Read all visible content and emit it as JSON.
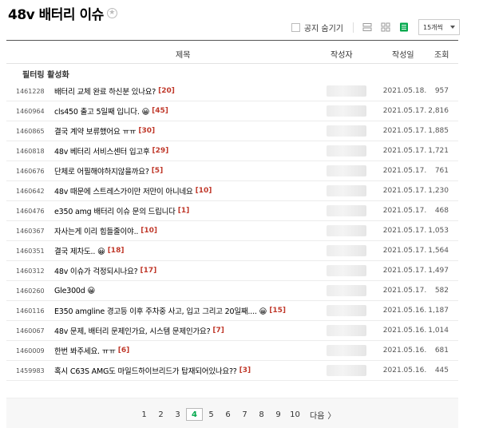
{
  "header": {
    "title": "48v 배터리 이슈"
  },
  "controls": {
    "notice_hide_label": "공지 숨기기",
    "page_size_selected": "15개씩",
    "accent_color": "#03a94d"
  },
  "table": {
    "columns": {
      "subject": "제목",
      "author": "작성자",
      "date": "작성일",
      "views": "조회"
    },
    "filter_label": "필터링 활성화",
    "rows": [
      {
        "no": "1461228",
        "subject": "배터리 교체 완료 하신분 있나요?",
        "comments": "[20]",
        "date": "2021.05.18.",
        "views": "957"
      },
      {
        "no": "1460964",
        "subject": "cls450 출고 5일째 입니다. 😀",
        "comments": "[45]",
        "date": "2021.05.17.",
        "views": "2,816"
      },
      {
        "no": "1460865",
        "subject": "결국 계약 보류했어요 ㅠㅠ",
        "comments": "[30]",
        "date": "2021.05.17.",
        "views": "1,885"
      },
      {
        "no": "1460818",
        "subject": "48v 베터리 서비스센터 입고후",
        "comments": "[29]",
        "date": "2021.05.17.",
        "views": "1,721"
      },
      {
        "no": "1460676",
        "subject": "단체로 어필해야하지않을까요?",
        "comments": "[5]",
        "date": "2021.05.17.",
        "views": "761"
      },
      {
        "no": "1460642",
        "subject": "48v 때문에 스트레스가이만 저만이 아니네요",
        "comments": "[10]",
        "date": "2021.05.17.",
        "views": "1,230"
      },
      {
        "no": "1460476",
        "subject": "e350 amg 배터리 이슈 문의 드립니다",
        "comments": "[1]",
        "date": "2021.05.17.",
        "views": "468"
      },
      {
        "no": "1460367",
        "subject": "자사는게 이리 힘들줄이야..",
        "comments": "[10]",
        "date": "2021.05.17.",
        "views": "1,053"
      },
      {
        "no": "1460351",
        "subject": "결국 제차도.. 😀",
        "comments": "[18]",
        "date": "2021.05.17.",
        "views": "1,564"
      },
      {
        "no": "1460312",
        "subject": "48v 이슈가 걱정되시나요?",
        "comments": "[17]",
        "date": "2021.05.17.",
        "views": "1,497"
      },
      {
        "no": "1460260",
        "subject": "Gle300d 😀",
        "comments": "",
        "date": "2021.05.17.",
        "views": "582"
      },
      {
        "no": "1460116",
        "subject": "E350 amgline 경고등 이후 주차중 사고, 입고 그리고 20일째.... 😀",
        "comments": "[15]",
        "date": "2021.05.16.",
        "views": "1,187"
      },
      {
        "no": "1460067",
        "subject": "48v 문제, 배터리 문제인가요, 시스템 문제인가요?",
        "comments": "[7]",
        "date": "2021.05.16.",
        "views": "1,014"
      },
      {
        "no": "1460009",
        "subject": "한번 봐주세요. ㅠㅠ",
        "comments": "[6]",
        "date": "2021.05.16.",
        "views": "681"
      },
      {
        "no": "1459983",
        "subject": "혹시 C63S AMG도 마일드하이브리드가 탑재되어있나요??",
        "comments": "[3]",
        "date": "2021.05.16.",
        "views": "445"
      }
    ]
  },
  "pagination": {
    "pages": [
      "1",
      "2",
      "3",
      "4",
      "5",
      "6",
      "7",
      "8",
      "9",
      "10"
    ],
    "current": "4",
    "next_label": "다음",
    "next_arrow": "〉"
  }
}
